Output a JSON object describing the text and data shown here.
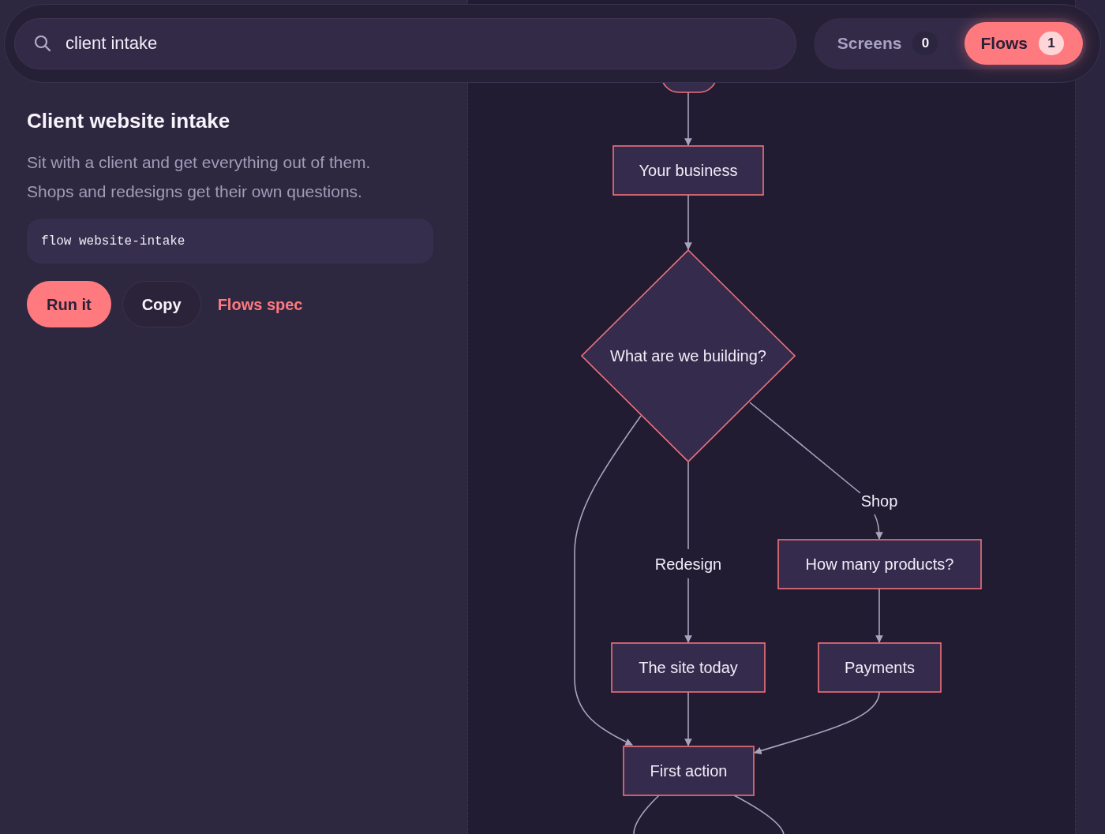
{
  "search": {
    "value": "client intake"
  },
  "tabs": [
    {
      "label": "Screens",
      "count": "0",
      "selected": false
    },
    {
      "label": "Flows",
      "count": "1",
      "selected": true
    }
  ],
  "flow": {
    "title": "Client website intake",
    "description": "Sit with a client and get everything out of them. Shops and redesigns get their own questions.",
    "command": "flow website-intake",
    "actions": [
      {
        "label": "Run it",
        "kind": "primary"
      },
      {
        "label": "Copy",
        "kind": "secondary"
      },
      {
        "label": "Flows spec",
        "kind": "link"
      }
    ]
  },
  "diagram": {
    "nodes": [
      {
        "kind": "start"
      },
      {
        "label": "Your business",
        "kind": "process"
      },
      {
        "label": "What are we building?",
        "kind": "decision"
      },
      {
        "label": "How many products?",
        "kind": "process"
      },
      {
        "label": "The site today",
        "kind": "process"
      },
      {
        "label": "Payments",
        "kind": "process"
      },
      {
        "label": "First action",
        "kind": "process"
      }
    ],
    "edge_labels": [
      "Redesign",
      "Shop"
    ]
  }
}
